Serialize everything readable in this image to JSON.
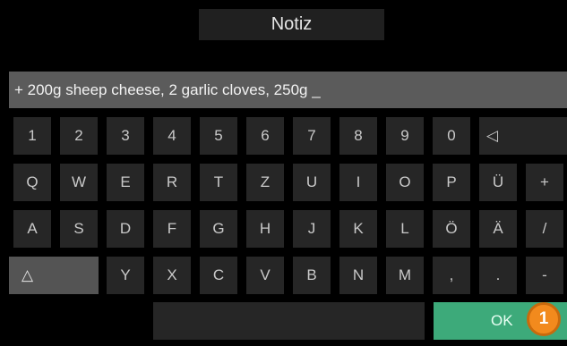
{
  "title": "Notiz",
  "note_text": "+ 200g sheep cheese, 2 garlic cloves, 250g _",
  "rows": {
    "numbers": [
      "1",
      "2",
      "3",
      "4",
      "5",
      "6",
      "7",
      "8",
      "9",
      "0"
    ],
    "row_q": [
      "Q",
      "W",
      "E",
      "R",
      "T",
      "Z",
      "U",
      "I",
      "O",
      "P",
      "Ü",
      "+"
    ],
    "row_a": [
      "A",
      "S",
      "D",
      "F",
      "G",
      "H",
      "J",
      "K",
      "L",
      "Ö",
      "Ä",
      "/"
    ],
    "row_y": [
      "Y",
      "X",
      "C",
      "V",
      "B",
      "N",
      "M",
      ",",
      ".",
      "-"
    ]
  },
  "keys": {
    "backspace": "◁",
    "shift": "△",
    "ok": "OK"
  },
  "badge": "1"
}
